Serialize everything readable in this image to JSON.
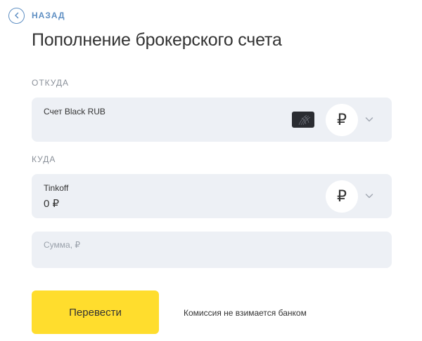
{
  "nav": {
    "back_label": "НАЗАД",
    "back_icon": "arrow-left-icon"
  },
  "page": {
    "title": "Пополнение брокерского счета"
  },
  "from": {
    "section_label": "ОТКУДА",
    "account_name": "Счет Black RUB",
    "card_icon": "bank-card-icon",
    "currency_symbol": "₽"
  },
  "to": {
    "section_label": "КУДА",
    "account_name": "Tinkoff",
    "balance": "0 ₽",
    "currency_symbol": "₽"
  },
  "amount": {
    "placeholder": "Сумма, ₽",
    "value": ""
  },
  "actions": {
    "submit_label": "Перевести"
  },
  "fee_note": "Комиссия не взимается банком",
  "colors": {
    "accent": "#5f8fc3",
    "field_bg": "#edf0f5",
    "button_bg": "#ffdd2d",
    "text": "#333333",
    "muted": "#8a9099"
  }
}
